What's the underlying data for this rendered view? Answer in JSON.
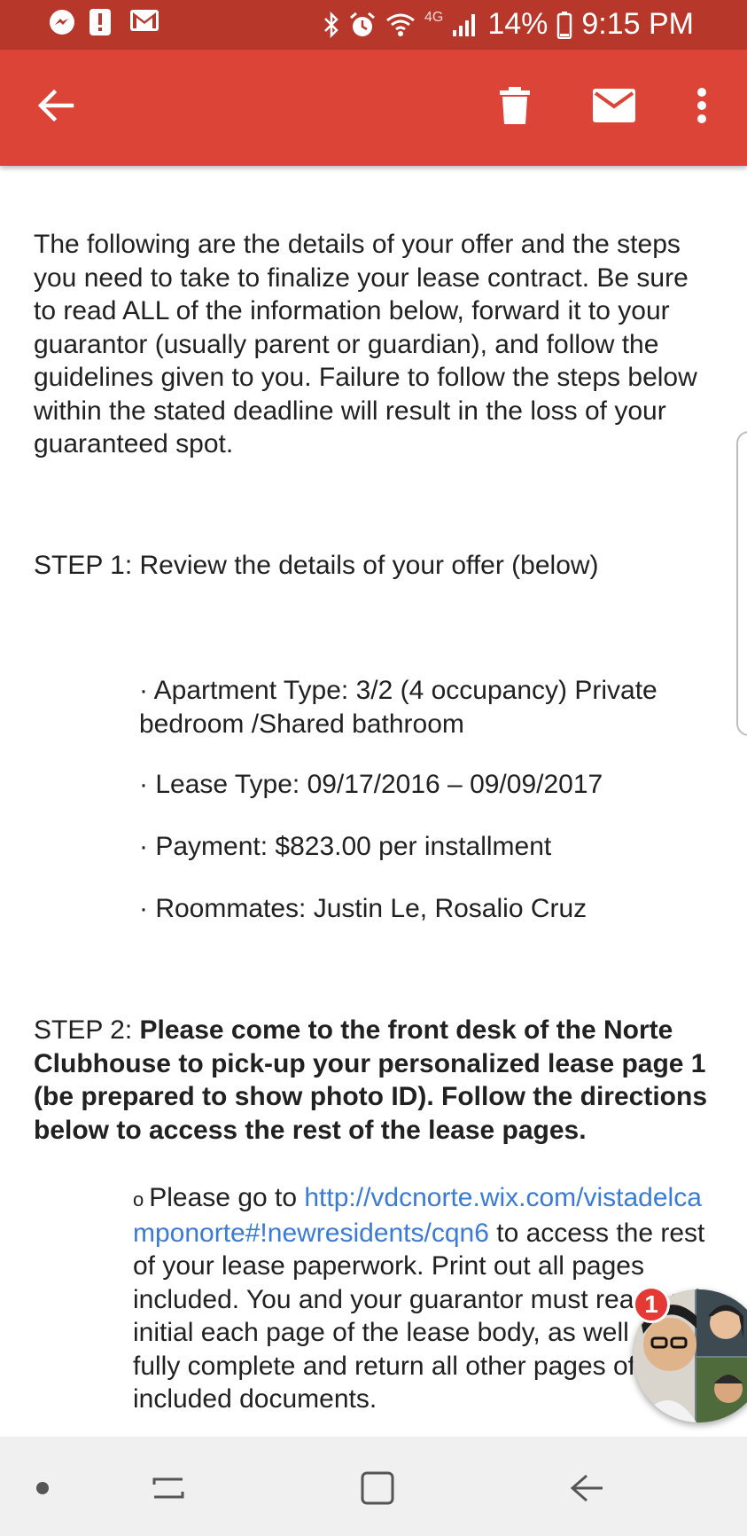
{
  "status_bar": {
    "battery": "14%",
    "time": "9:15 PM",
    "network": "4G",
    "left_icons": [
      "messenger-icon",
      "alert-icon",
      "gmail-icon"
    ],
    "right_icons": [
      "bluetooth-icon",
      "alarm-icon",
      "wifi-icon",
      "signal-icon",
      "battery-icon"
    ]
  },
  "toolbar": {
    "icons": [
      "back-arrow-icon",
      "trash-icon",
      "mail-icon",
      "more-vert-icon"
    ]
  },
  "email": {
    "intro": "The following are the details of your offer and the steps you need to take to finalize your lease contract. Be sure to read ALL of the information below, forward it to your guarantor (usually parent or guardian), and follow the guidelines given to you. Failure to follow the steps below within the stated deadline will result in the loss of your guaranteed spot.",
    "step1": "STEP 1: Review the details of your offer (below)",
    "bullets": [
      "· Apartment Type: 3/2 (4 occupancy) Private bedroom /Shared bathroom",
      "· Lease Type: 09/17/2016 – 09/09/2017",
      "· Payment: $823.00 per installment",
      "· Roommates:  Justin Le, Rosalio Cruz"
    ],
    "step2_prefix": "STEP 2: ",
    "step2_bold": "Please come to the front desk of the Norte Clubhouse to pick-up your personalized lease page 1 (be prepared to show photo ID). Follow the directions below to access the rest of the lease pages.",
    "sub_marker": "o",
    "sub_before": "Please go to ",
    "sub_link": "http://vdcnorte.wix.com/vistadelcamponorte#!newresidents/cqn6",
    "sub_after": " to access the rest of your lease paperwork. Print out all pages included. You and your guarantor must read and initial each page of the lease body, as well as fully complete and return all other pages of the included documents."
  },
  "chat_head": {
    "badge": "1"
  },
  "nav_bar": {
    "icons": [
      "dot-icon",
      "recents-icon",
      "home-icon",
      "back-icon"
    ]
  },
  "colors": {
    "status_bar": "#b7372b",
    "toolbar": "#db4437",
    "link": "#3a7bd5",
    "badge": "#e53935"
  }
}
